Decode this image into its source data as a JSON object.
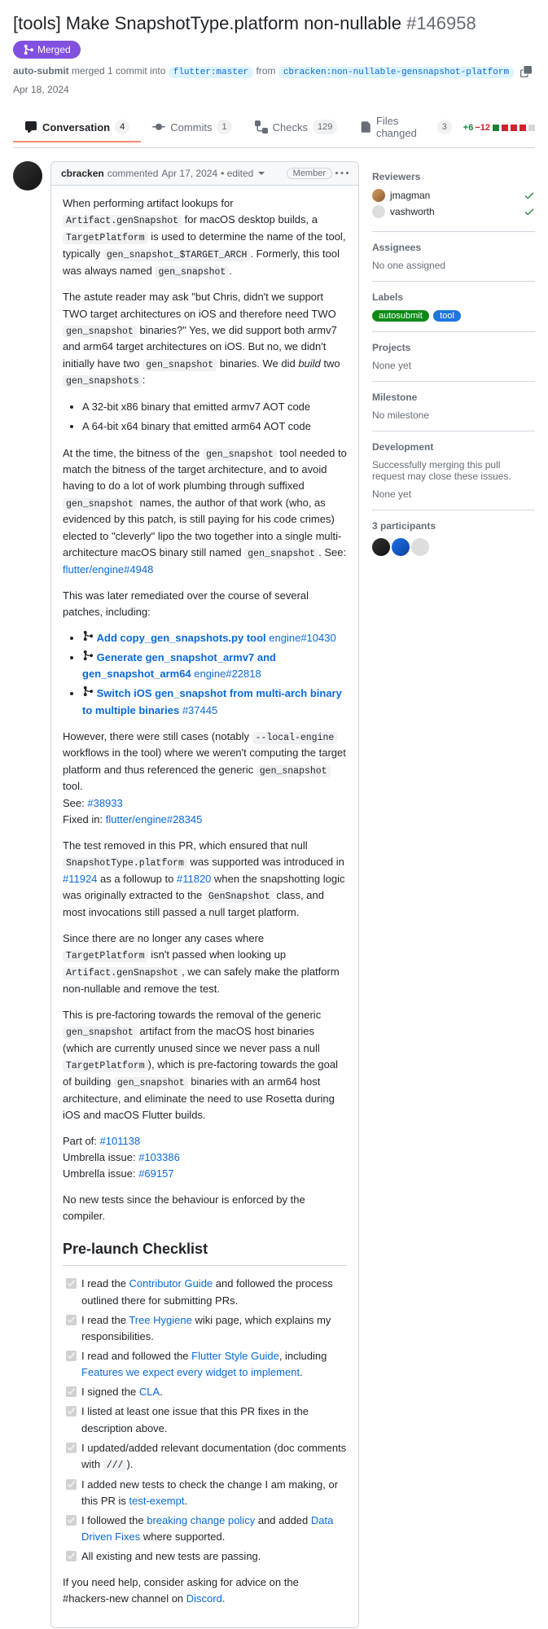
{
  "pr": {
    "title": "[tools] Make SnapshotType.platform non-nullable",
    "number": "#146958",
    "state": "Merged",
    "merge_line_author": "auto-submit",
    "merge_line_text1": " merged 1 commit into ",
    "merge_line_branch_into": "flutter:master",
    "merge_line_text2": " from ",
    "merge_line_branch_from": "cbracken:non-nullable-gensnapshot-platform",
    "merge_date": "Apr 18, 2024"
  },
  "tabs": {
    "conversation": {
      "label": "Conversation",
      "count": "4"
    },
    "commits": {
      "label": "Commits",
      "count": "1"
    },
    "checks": {
      "label": "Checks",
      "count": "129"
    },
    "files": {
      "label": "Files changed",
      "count": "3"
    }
  },
  "diffstat": {
    "plus": "+6",
    "minus": "−12"
  },
  "comment": {
    "author": "cbracken",
    "action": " commented ",
    "date": "Apr 17, 2024",
    "edited": " • edited ",
    "role": "Member"
  },
  "body": {
    "p1a": "When performing artifact lookups for ",
    "c1": "Artifact.genSnapshot",
    "p1b": " for macOS desktop builds, a ",
    "c2": "TargetPlatform",
    "p1c": " is used to determine the name of the tool, typically ",
    "c3": "gen_snapshot_$TARGET_ARCH",
    "p1d": ". Formerly, this tool was always named ",
    "c4": "gen_snapshot",
    "p1e": ".",
    "p2a": "The astute reader may ask \"but Chris, didn't we support TWO target architectures on iOS and therefore need TWO ",
    "c5": "gen_snapshot",
    "p2b": " binaries?\" Yes, we did support both armv7 and arm64 target architectures on iOS. But no, we didn't initially have two ",
    "c6": "gen_snapshot",
    "p2c": " binaries. We did ",
    "p2d": "build",
    "p2e": " two ",
    "c7": "gen_snapshots",
    "p2f": ":",
    "li1": "A 32-bit x86 binary that emitted armv7 AOT code",
    "li2": "A 64-bit x64 binary that emitted arm64 AOT code",
    "p3a": "At the time, the bitness of the ",
    "c8": "gen_snapshot",
    "p3b": " tool needed to match the bitness of the target architecture, and to avoid having to do a lot of work plumbing through suffixed ",
    "c9": "gen_snapshot",
    "p3c": " names, the author of that work (who, as evidenced by this patch, is still paying for his code crimes) elected to \"cleverly\" lipo the two together into a single multi-architecture macOS binary still named ",
    "c10": "gen_snapshot",
    "p3d": ". See: ",
    "l1": "flutter/engine#4948",
    "p4": "This was later remediated over the course of several patches, including:",
    "mli1a": "Add copy_gen_snapshots.py tool",
    "mli1b": "engine#10430",
    "mli2a": "Generate gen_snapshot_armv7 and gen_snapshot_arm64",
    "mli2b": "engine#22818",
    "mli3a": "Switch iOS gen_snapshot from multi-arch binary to multiple binaries",
    "mli3b": "#37445",
    "p5a": "However, there were still cases (notably ",
    "c11": "--local-engine",
    "p5b": " workflows in the tool) where we weren't computing the target platform and thus referenced the generic ",
    "c12": "gen_snapshot",
    "p5c": " tool.",
    "p5d": "See: ",
    "l2": "#38933",
    "p5e": "Fixed in: ",
    "l3": "flutter/engine#28345",
    "p6a": "The test removed in this PR, which ensured that null ",
    "c13": "SnapshotType.platform",
    "p6b": " was supported was introduced in ",
    "l4": "#11924",
    "p6c": " as a followup to ",
    "l5": "#11820",
    "p6d": " when the snapshotting logic was originally extracted to the ",
    "c14": "GenSnapshot",
    "p6e": " class, and most invocations still passed a null target platform.",
    "p7a": "Since there are no longer any cases where ",
    "c15": "TargetPlatform",
    "p7b": " isn't passed when looking up ",
    "c16": "Artifact.genSnapshot",
    "p7c": ", we can safely make the platform non-nullable and remove the test.",
    "p8a": "This is pre-factoring towards the removal of the generic ",
    "c17": "gen_snapshot",
    "p8b": " artifact from the macOS host binaries (which are currently unused since we never pass a null ",
    "c18": "TargetPlatform",
    "p8c": "), which is pre-factoring towards the goal of building ",
    "c19": "gen_snapshot",
    "p8d": " binaries with an arm64 host architecture, and eliminate the need to use Rosetta during iOS and macOS Flutter builds.",
    "p9a": "Part of: ",
    "l6": "#101138",
    "p9b": "Umbrella issue: ",
    "l7": "#103386",
    "p9c": "Umbrella issue: ",
    "l8": "#69157",
    "p10": "No new tests since the behaviour is enforced by the compiler.",
    "h2": "Pre-launch Checklist",
    "chk1a": "I read the ",
    "chk1l": "Contributor Guide",
    "chk1b": " and followed the process outlined there for submitting PRs.",
    "chk2a": "I read the ",
    "chk2l": "Tree Hygiene",
    "chk2b": " wiki page, which explains my responsibilities.",
    "chk3a": "I read and followed the ",
    "chk3l": "Flutter Style Guide",
    "chk3b": ", including ",
    "chk3l2": "Features we expect every widget to implement",
    "chk3c": ".",
    "chk4a": "I signed the ",
    "chk4l": "CLA",
    "chk4b": ".",
    "chk5": "I listed at least one issue that this PR fixes in the description above.",
    "chk6a": "I updated/added relevant documentation (doc comments with ",
    "chk6c": "///",
    "chk6b": ").",
    "chk7a": "I added new tests to check the change I am making, or this PR is ",
    "chk7l": "test-exempt",
    "chk7b": ".",
    "chk8a": "I followed the ",
    "chk8l": "breaking change policy",
    "chk8b": " and added ",
    "chk8l2": "Data Driven Fixes",
    "chk8c": " where supported.",
    "chk9": "All existing and new tests are passing.",
    "p11a": "If you need help, consider asking for advice on the #hackers-new channel on ",
    "l9": "Discord",
    "p11b": "."
  },
  "sidebar": {
    "reviewers_h": "Reviewers",
    "reviewer1": "jmagman",
    "reviewer2": "vashworth",
    "assignees_h": "Assignees",
    "assignees_v": "No one assigned",
    "labels_h": "Labels",
    "label1": "autosubmit",
    "label2": "tool",
    "projects_h": "Projects",
    "projects_v": "None yet",
    "milestone_h": "Milestone",
    "milestone_v": "No milestone",
    "dev_h": "Development",
    "dev_v": "Successfully merging this pull request may close these issues.",
    "dev_v2": "None yet",
    "participants_h": "3 participants"
  }
}
